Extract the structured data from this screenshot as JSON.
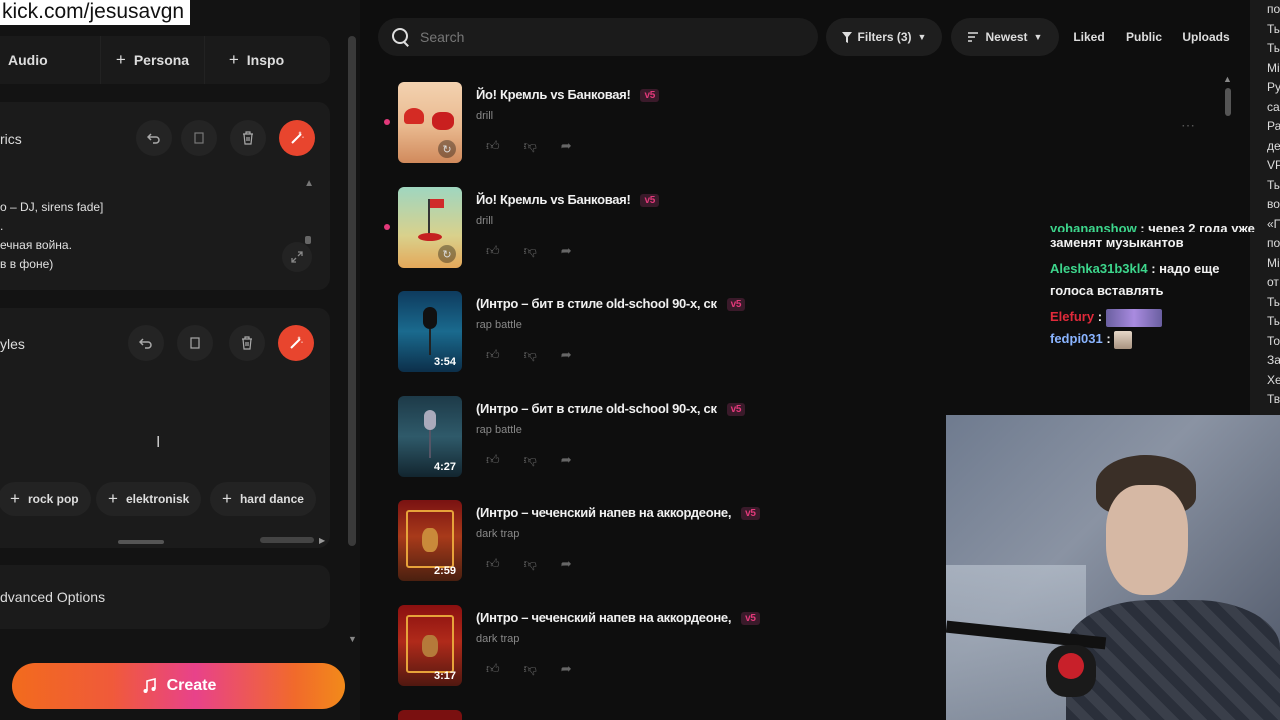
{
  "stream_url": "kick.com/jesusavgn",
  "left": {
    "tabs": {
      "audio": "Audio",
      "persona": "Persona",
      "inspo": "Inspo"
    },
    "lyrics": {
      "title": "rics",
      "lines": [
        "o – DJ, sirens fade]",
        ".",
        "ечная война.",
        "в в фоне)"
      ]
    },
    "styles": {
      "title": "yles",
      "chips": [
        "rock pop",
        "elektronisk",
        "hard dance"
      ]
    },
    "advanced": "dvanced Options",
    "create": "Create"
  },
  "topbar": {
    "search_placeholder": "Search",
    "filters": "Filters (3)",
    "sort": "Newest",
    "liked": "Liked",
    "public": "Public",
    "uploads": "Uploads"
  },
  "songs": [
    {
      "title": "Йо! Кремль vs Банковая!",
      "version": "v5",
      "genre": "drill",
      "duration": "",
      "loading": true,
      "new": true
    },
    {
      "title": "Йо! Кремль vs Банковая!",
      "version": "v5",
      "genre": "drill",
      "duration": "",
      "loading": true,
      "new": true
    },
    {
      "title": "(Интро – бит в стиле old-school 90-х, ск",
      "version": "v5",
      "genre": "rap battle",
      "duration": "3:54",
      "loading": false,
      "new": false
    },
    {
      "title": "(Интро – бит в стиле old-school 90-х, ск",
      "version": "v5",
      "genre": "rap battle",
      "duration": "4:27",
      "loading": false,
      "new": false
    },
    {
      "title": "(Интро – чеченский напев на аккордеоне,",
      "version": "v5",
      "genre": "dark trap",
      "duration": "2:59",
      "loading": false,
      "new": false
    },
    {
      "title": "(Интро – чеченский напев на аккордеоне,",
      "version": "v5",
      "genre": "dark trap",
      "duration": "3:17",
      "loading": false,
      "new": false
    }
  ],
  "chat": {
    "right_column": [
      "по",
      "Ты",
      "Ты",
      "Мі",
      "Ру",
      "са",
      "Ра",
      "де",
      "VP",
      "Ты",
      "во",
      "«П",
      "по",
      "Мі",
      "от",
      "Ты",
      "Ты",
      "То",
      "За",
      "Хе",
      "Тв"
    ],
    "messages": [
      {
        "user": "yohananshow",
        "text": "через 2 года уже",
        "cont": "заменят музыкантов"
      },
      {
        "user": "Aleshka31b3kl4",
        "text": "надо еще",
        "cont": "голоса вставлять"
      },
      {
        "user": "Elefury",
        "text": ""
      },
      {
        "user": "fedpi031",
        "text": ""
      }
    ]
  },
  "colors": {
    "accent": "#e8452e",
    "version_badge": "#e2397a"
  }
}
